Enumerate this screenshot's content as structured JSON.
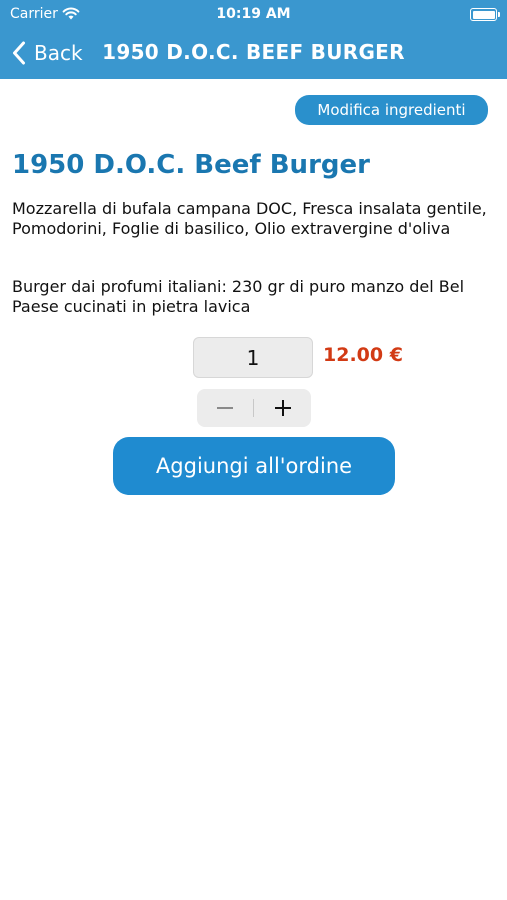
{
  "status_bar": {
    "carrier": "Carrier",
    "time": "10:19 AM",
    "wifi_icon": "wifi-icon",
    "battery_icon": "battery-icon"
  },
  "nav": {
    "back_label": "Back",
    "back_icon": "chevron-left-icon",
    "title": "1950 D.O.C. BEEF BURGER",
    "color": "#3a97cf"
  },
  "edit_button": {
    "label": "Modifica ingredienti"
  },
  "product": {
    "name": "1950 D.O.C. Beef Burger",
    "ingredients": "Mozzarella di bufala campana DOC, Fresca insalata gentile, Pomodorini, Foglie di basilico, Olio extravergine d'oliva",
    "description": "Burger dai profumi italiani: 230 gr di puro manzo del Bel Paese cucinati in pietra lavica",
    "quantity": "1",
    "price": "12.00 €",
    "price_color": "#d23a14"
  },
  "stepper": {
    "minus_icon": "minus-icon",
    "plus_icon": "plus-icon"
  },
  "add_button": {
    "label": "Aggiungi all'ordine",
    "color": "#1f8bd0"
  }
}
